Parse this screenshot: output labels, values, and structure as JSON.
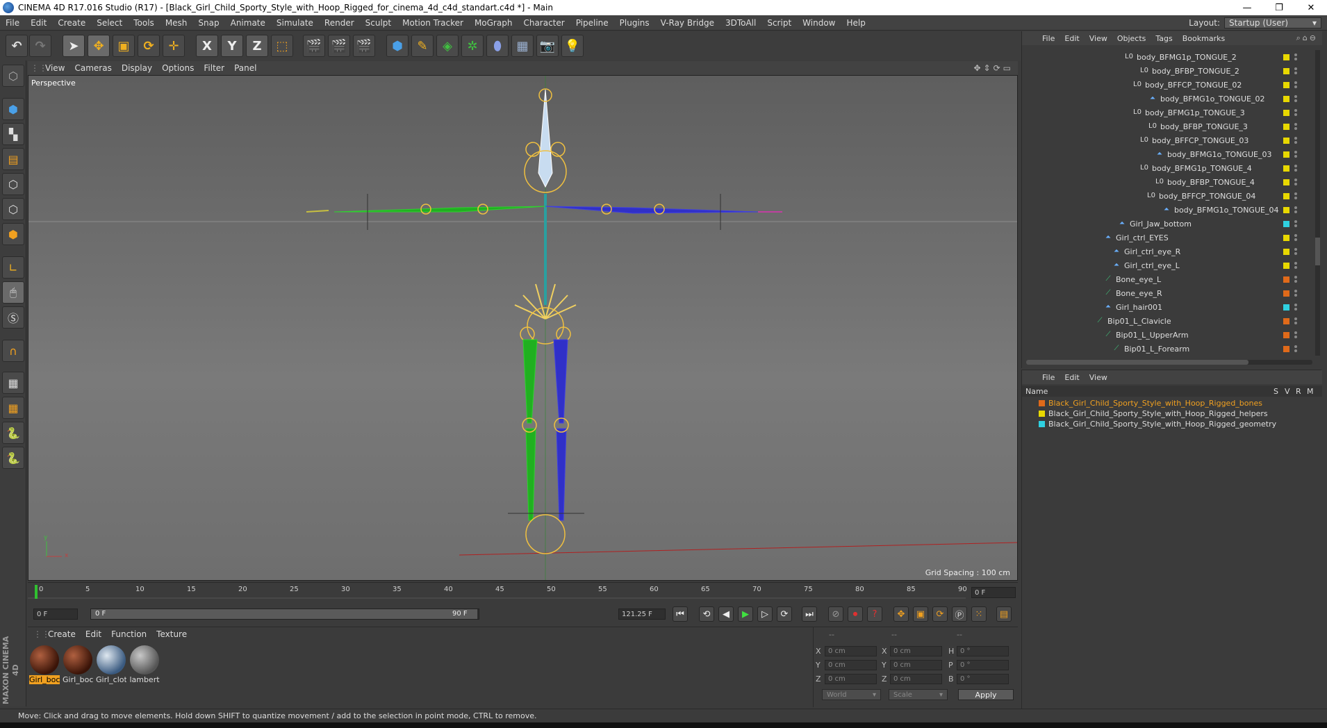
{
  "window": {
    "title": "CINEMA 4D R17.016 Studio (R17) - [Black_Girl_Child_Sporty_Style_with_Hoop_Rigged_for_cinema_4d_c4d_standart.c4d *] - Main",
    "controls": {
      "min": "—",
      "max": "❐",
      "close": "✕"
    }
  },
  "menu": [
    "File",
    "Edit",
    "Create",
    "Select",
    "Tools",
    "Mesh",
    "Snap",
    "Animate",
    "Simulate",
    "Render",
    "Sculpt",
    "Motion Tracker",
    "MoGraph",
    "Character",
    "Pipeline",
    "Plugins",
    "V-Ray Bridge",
    "3DToAll",
    "Script",
    "Window",
    "Help"
  ],
  "layout": {
    "label": "Layout:",
    "value": "Startup (User)"
  },
  "toolbar": {
    "x": "X",
    "y": "Y",
    "z": "Z"
  },
  "viewport": {
    "menu": [
      "View",
      "Cameras",
      "Display",
      "Options",
      "Filter",
      "Panel"
    ],
    "name": "Perspective",
    "grid_spacing": "Grid Spacing : 100 cm",
    "axis_x": "x",
    "axis_y": "y"
  },
  "timeline": {
    "ticks": [
      "0",
      "5",
      "10",
      "15",
      "20",
      "25",
      "30",
      "35",
      "40",
      "45",
      "50",
      "55",
      "60",
      "65",
      "70",
      "75",
      "80",
      "85",
      "90"
    ],
    "current_frame": "0 F"
  },
  "transport": {
    "start": "0 F",
    "range_start": "0 F",
    "range_end": "90 F",
    "end": "121.25 F"
  },
  "materials": {
    "menu": [
      "Create",
      "Edit",
      "Function",
      "Texture"
    ],
    "items": [
      {
        "name": "Girl_boc",
        "color": "#5a2a18"
      },
      {
        "name": "Girl_boc",
        "color": "#5a2a18"
      },
      {
        "name": "Girl_clot",
        "color": "#7d9bb8"
      },
      {
        "name": "lambert",
        "color": "#9a9a9a"
      }
    ]
  },
  "coords": {
    "header": [
      "--",
      "--",
      "--"
    ],
    "x_pos": "0 cm",
    "y_pos": "0 cm",
    "z_pos": "0 cm",
    "x_size": "0 cm",
    "y_size": "0 cm",
    "z_size": "0 cm",
    "h": "0 °",
    "p": "0 °",
    "b": "0 °",
    "labels": {
      "x": "X",
      "y": "Y",
      "z": "Z",
      "h": "H",
      "p": "P",
      "b": "B"
    },
    "world": "World",
    "scale": "Scale",
    "apply": "Apply"
  },
  "objects": {
    "menu": [
      "File",
      "Edit",
      "View",
      "Objects",
      "Tags",
      "Bookmarks"
    ],
    "rows": [
      {
        "name": "body_BFMG1p_TONGUE_2",
        "tag": "#e8d800"
      },
      {
        "name": "body_BFBP_TONGUE_2",
        "tag": "#e8d800"
      },
      {
        "name": "body_BFFCP_TONGUE_02",
        "tag": "#e8d800"
      },
      {
        "name": "body_BFMG1o_TONGUE_02",
        "tag": "#e8d800"
      },
      {
        "name": "body_BFMG1p_TONGUE_3",
        "tag": "#e8d800"
      },
      {
        "name": "body_BFBP_TONGUE_3",
        "tag": "#e8d800"
      },
      {
        "name": "body_BFFCP_TONGUE_03",
        "tag": "#e8d800"
      },
      {
        "name": "body_BFMG1o_TONGUE_03",
        "tag": "#e8d800"
      },
      {
        "name": "body_BFMG1p_TONGUE_4",
        "tag": "#e8d800"
      },
      {
        "name": "body_BFBP_TONGUE_4",
        "tag": "#e8d800"
      },
      {
        "name": "body_BFFCP_TONGUE_04",
        "tag": "#e8d800"
      },
      {
        "name": "body_BFMG1o_TONGUE_04",
        "tag": "#e8d800"
      },
      {
        "name": "Girl_Jaw_bottom",
        "tag": "#2fd0e0"
      },
      {
        "name": "Girl_ctrl_EYES",
        "tag": "#e8d800"
      },
      {
        "name": "Girl_ctrl_eye_R",
        "tag": "#e8d800"
      },
      {
        "name": "Girl_ctrl_eye_L",
        "tag": "#e8d800"
      },
      {
        "name": "Bone_eye_L",
        "tag": "#e06a1a"
      },
      {
        "name": "Bone_eye_R",
        "tag": "#e06a1a"
      },
      {
        "name": "Girl_hair001",
        "tag": "#2fd0e0"
      },
      {
        "name": "Bip01_L_Clavicle",
        "tag": "#e06a1a"
      },
      {
        "name": "Bip01_L_UpperArm",
        "tag": "#e06a1a"
      },
      {
        "name": "Bip01_L_Forearm",
        "tag": "#e06a1a"
      }
    ]
  },
  "layers": {
    "menu": [
      "File",
      "Edit",
      "View"
    ],
    "header": {
      "name": "Name",
      "s": "S",
      "v": "V",
      "r": "R",
      "m": "M"
    },
    "rows": [
      {
        "name": "Black_Girl_Child_Sporty_Style_with_Hoop_Rigged_bones",
        "color": "#e06a1a",
        "text": "#f0a020"
      },
      {
        "name": "Black_Girl_Child_Sporty_Style_with_Hoop_Rigged_helpers",
        "color": "#e8d800",
        "text": "#dddddd"
      },
      {
        "name": "Black_Girl_Child_Sporty_Style_with_Hoop_Rigged_geometry",
        "color": "#2fd0e0",
        "text": "#dddddd"
      }
    ]
  },
  "status": "Move: Click and drag to move elements. Hold down SHIFT to quantize movement / add to the selection in point mode, CTRL to remove.",
  "maxon": "MAXON CINEMA 4D"
}
